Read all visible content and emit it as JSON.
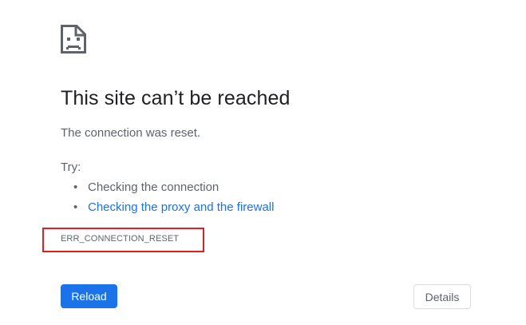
{
  "icon": "sad-page-icon",
  "title": "This site can’t be reached",
  "subtitle": "The connection was reset.",
  "try_label": "Try:",
  "suggestions": [
    {
      "text": "Checking the connection",
      "is_link": false
    },
    {
      "text": "Checking the proxy and the firewall",
      "is_link": true
    }
  ],
  "error_code": "ERR_CONNECTION_RESET",
  "buttons": {
    "reload": "Reload",
    "details": "Details"
  },
  "colors": {
    "link": "#1a73e8",
    "primary_button": "#1a73e8",
    "highlight_box": "#e02020",
    "text": "#202124",
    "muted_text": "#5f6368"
  }
}
